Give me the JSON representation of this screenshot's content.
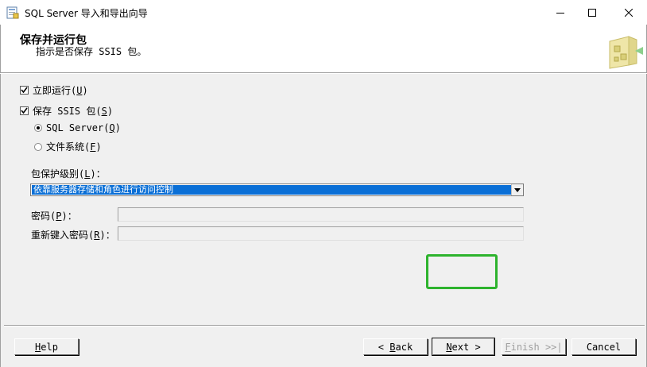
{
  "window": {
    "title": "SQL Server 导入和导出向导",
    "minimize_icon": "minimize-icon",
    "maximize_icon": "maximize-icon",
    "close_icon": "close-icon"
  },
  "header": {
    "title": "保存并运行包",
    "subtitle": "指示是否保存 SSIS 包。"
  },
  "options": {
    "run_now": {
      "label": "立即运行(",
      "mnemonic": "U",
      "suffix": ")",
      "checked": true
    },
    "save_ssis": {
      "label": "保存 SSIS 包(",
      "mnemonic": "S",
      "suffix": ")",
      "checked": true
    },
    "sql_server": {
      "label": "SQL Server(",
      "mnemonic": "Q",
      "suffix": ")",
      "selected": true
    },
    "file_system": {
      "label": "文件系统(",
      "mnemonic": "F",
      "suffix": ")",
      "selected": false
    }
  },
  "protection": {
    "label": "包保护级别(",
    "mnemonic": "L",
    "suffix": ")：",
    "selected_value": "依靠服务器存储和角色进行访问控制"
  },
  "password": {
    "label": "密码(",
    "mnemonic": "P",
    "suffix": ")：",
    "value": ""
  },
  "reenter_password": {
    "label": "重新键入密码(",
    "mnemonic": "R",
    "suffix": ")：",
    "value": ""
  },
  "buttons": {
    "help": {
      "mnemonic": "H",
      "rest": "elp"
    },
    "back": {
      "prefix": "< ",
      "mnemonic": "B",
      "rest": "ack"
    },
    "next": {
      "mnemonic": "N",
      "rest": "ext >"
    },
    "finish": {
      "mnemonic": "F",
      "rest": "inish >>|"
    },
    "cancel": {
      "label": "Cancel"
    }
  },
  "colors": {
    "selection": "#0a6fd6",
    "highlight_frame": "#2db32d"
  }
}
